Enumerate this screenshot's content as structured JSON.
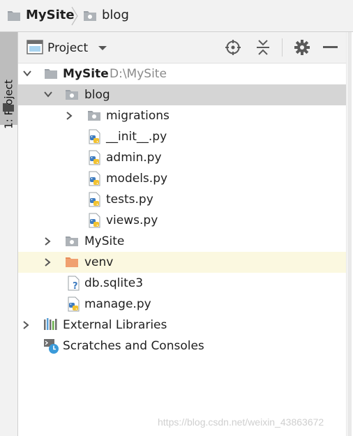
{
  "breadcrumb": {
    "project": "MySite",
    "folder": "blog"
  },
  "side_stripe": {
    "project_tab": "1: Project"
  },
  "panel": {
    "title": "Project",
    "icons": [
      "locate-icon",
      "collapse-all-icon",
      "gear-icon",
      "minimize-icon"
    ]
  },
  "tree": {
    "root": {
      "name": "MySite",
      "path": "D:\\MySite"
    },
    "blog": "blog",
    "migrations": "migrations",
    "init": "__init__.py",
    "admin": "admin.py",
    "models": "models.py",
    "tests": "tests.py",
    "views": "views.py",
    "mysite_pkg": "MySite",
    "venv": "venv",
    "db": "db.sqlite3",
    "manage": "manage.py",
    "ext_libs": "External Libraries",
    "scratches": "Scratches and Consoles"
  },
  "watermark": "https://blog.csdn.net/weixin_43863672"
}
